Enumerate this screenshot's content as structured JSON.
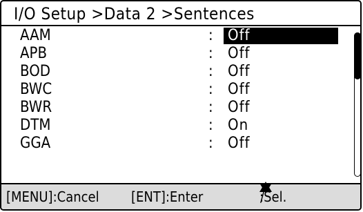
{
  "title": "I/O Setup >Data 2 >Sentences",
  "separator": ":",
  "sentences": [
    {
      "label": "AAM",
      "value": "Off",
      "selected": true
    },
    {
      "label": "APB",
      "value": "Off",
      "selected": false
    },
    {
      "label": "BOD",
      "value": "Off",
      "selected": false
    },
    {
      "label": "BWC",
      "value": "Off",
      "selected": false
    },
    {
      "label": "BWR",
      "value": "Off",
      "selected": false
    },
    {
      "label": "DTM",
      "value": "On",
      "selected": false
    },
    {
      "label": "GGA",
      "value": "Off",
      "selected": false
    }
  ],
  "footer": {
    "cancel": "[MENU]:Cancel",
    "enter": "[ENT]:Enter",
    "select_slash": "/",
    "select_suffix": ":Sel."
  },
  "icons": {
    "up": "triangle-up",
    "down": "triangle-down"
  },
  "colors": {
    "highlight_bg": "#000000",
    "highlight_fg": "#ffffff",
    "footer_bg": "#dcdcdc"
  }
}
